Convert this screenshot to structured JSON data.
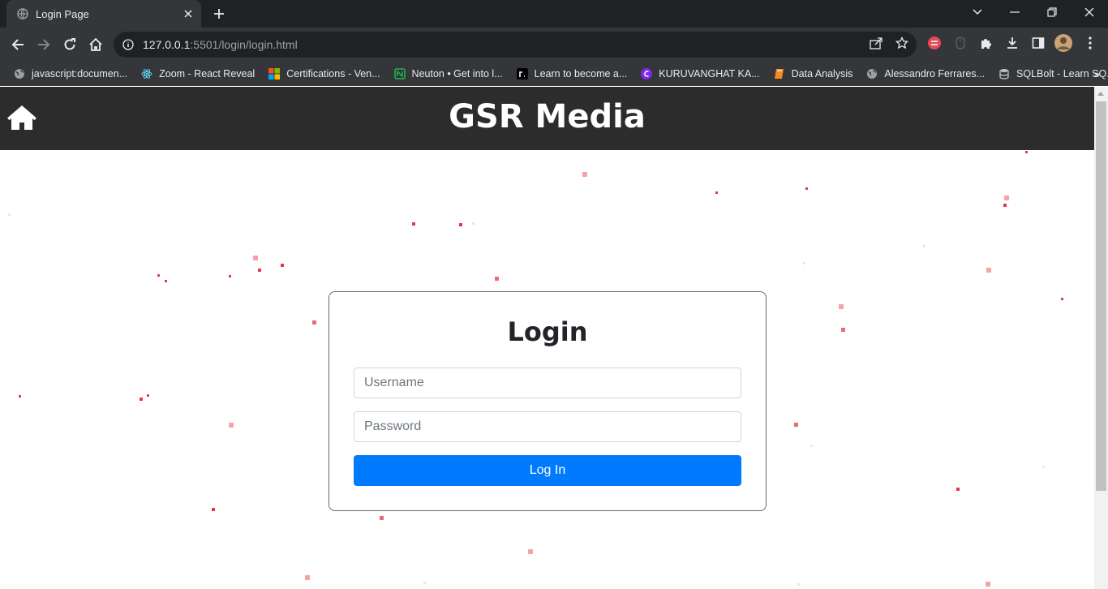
{
  "browser": {
    "tab": {
      "title": "Login Page"
    },
    "address": {
      "host": "127.0.0.1",
      "rest": ":5501/login/login.html"
    },
    "bookmarks": [
      {
        "label": "javascript:documen...",
        "icon": "globe-icon"
      },
      {
        "label": "Zoom - React Reveal",
        "icon": "react-icon"
      },
      {
        "label": "Certifications - Ven...",
        "icon": "microsoft-icon"
      },
      {
        "label": "Neuton • Get into l...",
        "icon": "neuton-icon"
      },
      {
        "label": "Learn to become a...",
        "icon": "roadmap-icon"
      },
      {
        "label": "KURUVANGHAT KA...",
        "icon": "canva-icon"
      },
      {
        "label": "Data Analysis",
        "icon": "book-icon"
      },
      {
        "label": "Alessandro Ferrares...",
        "icon": "globe-icon"
      },
      {
        "label": "SQLBolt - Learn SQ...",
        "icon": "database-icon"
      }
    ],
    "more_bookmarks": "»"
  },
  "site": {
    "title": "GSR Media",
    "home_icon": "home-icon"
  },
  "login": {
    "heading": "Login",
    "username_placeholder": "Username",
    "password_placeholder": "Password",
    "submit_label": "Log In"
  },
  "colors": {
    "header_bg": "#2c2c2c",
    "button_bg": "#007bff",
    "particle": "#e63946"
  }
}
